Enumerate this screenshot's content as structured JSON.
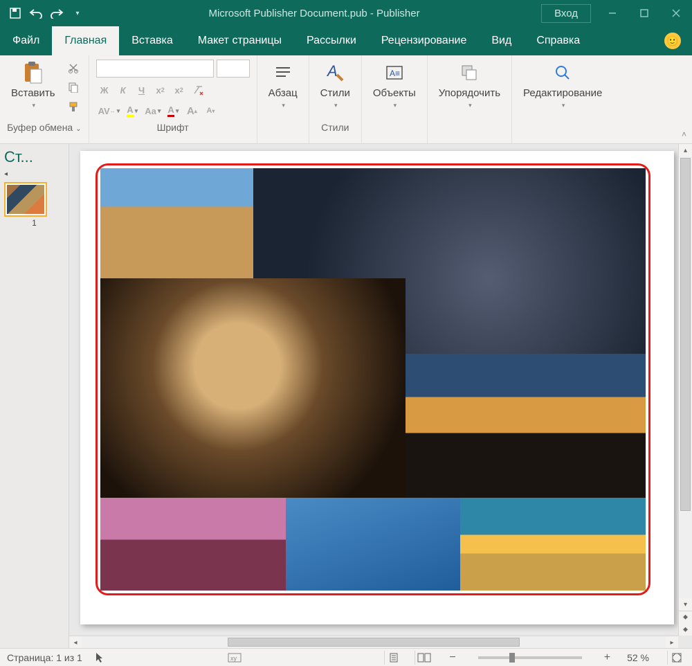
{
  "titlebar": {
    "title": "Microsoft Publisher Document.pub  -  Publisher",
    "signin": "Вход"
  },
  "tabs": [
    "Файл",
    "Главная",
    "Вставка",
    "Макет страницы",
    "Рассылки",
    "Рецензирование",
    "Вид",
    "Справка"
  ],
  "active_tab_index": 1,
  "ribbon": {
    "clipboard": {
      "paste": "Вставить",
      "group": "Буфер обмена"
    },
    "font": {
      "group": "Шрифт",
      "bold": "Ж",
      "italic": "К",
      "underline": "Ч",
      "sub": "x₂",
      "sup": "x²",
      "spacing": "AV",
      "highlight": "A",
      "case": "Aa",
      "fontcolor": "A",
      "grow": "A",
      "shrink": "A"
    },
    "paragraph": {
      "label": "Абзац"
    },
    "styles": {
      "label": "Стили",
      "group": "Стили"
    },
    "objects": {
      "label": "Объекты"
    },
    "arrange": {
      "label": "Упорядочить"
    },
    "editing": {
      "label": "Редактирование"
    }
  },
  "pages": {
    "title": "Ст...",
    "thumb_number": "1"
  },
  "status": {
    "page": "Страница: 1 из 1",
    "zoom": "52 %"
  },
  "collage_images": [
    "desert-monument-valley",
    "city-aerial-night",
    "cheetah-face",
    "bokeh-sunset",
    "tulip-field-sunset",
    "surfer-wave",
    "ocean-sunset"
  ]
}
